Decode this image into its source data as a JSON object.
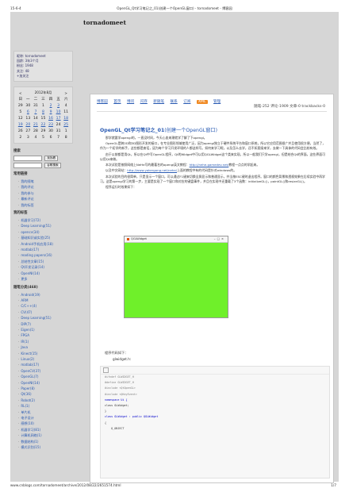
{
  "pdf": {
    "date": "15-6-4",
    "title": "OpenGL_Qt学习笔记之_01(创建一个OpenGL窗口) - tornadomeet - 博客园",
    "url": "www.cnblogs.com/tornadomeet/archive/2012/08/22/2651574.html",
    "page": "1/7"
  },
  "blog": {
    "title": "tornadomeet"
  },
  "sidebar": {
    "info": [
      "昵称: tornadomeet",
      "园龄: 3年3个月",
      "粉丝: 1948",
      "关注: 48",
      "+加关注"
    ],
    "calendar": {
      "prev": "<",
      "caption": "2012年8月",
      "next": ">",
      "weekdays": [
        "日",
        "一",
        "二",
        "三",
        "四",
        "五",
        "六"
      ],
      "rows": [
        [
          "29",
          "30",
          "31",
          "1",
          "2",
          "3",
          "4"
        ],
        [
          "5",
          "6",
          "7",
          "8",
          "9",
          "10",
          "11"
        ],
        [
          "12",
          "13",
          "14",
          "15",
          "16",
          "17",
          "18"
        ],
        [
          "19",
          "20",
          "21",
          "22",
          "23",
          "24",
          "25"
        ],
        [
          "26",
          "27",
          "28",
          "29",
          "30",
          "31",
          "1"
        ],
        [
          "2",
          "3",
          "4",
          "5",
          "6",
          "7",
          "8"
        ]
      ]
    },
    "search": {
      "heading": "搜索",
      "button1": "找找看",
      "button2": "谷歌搜索"
    },
    "common_links": {
      "heading": "常用链接",
      "items": [
        "我的随笔",
        "我的评论",
        "我的参与",
        "最新评论",
        "我的标签"
      ]
    },
    "my_tags": {
      "heading": "我的标签",
      "items": [
        "机器学习(72)",
        "Deep Learning(51)",
        "opencv(34)",
        "基础知识或实验(25)",
        "Android手机应用(18)",
        "matlab(17)",
        "reading papers(16)",
        "总结性文章(15)",
        "Qt开发记录(14)",
        "OpenNI(14)",
        "更多"
      ]
    },
    "categories": {
      "heading": "随笔分类(468)",
      "items": [
        "Android(19)",
        "ARM",
        "C/C++(4)",
        "CV(47)",
        "Deep Learning(51)",
        "DIP(7)",
        "Eigen(1)",
        "FPGA",
        "IR(1)",
        "Java",
        "Kinect(15)",
        "Linux(2)",
        "matlab(17)",
        "OpenCV(37)",
        "OpenGL(7)",
        "OpenNI(14)",
        "Paper(8)",
        "Qt(36)",
        "Robot(2)",
        "RL(1)",
        "单片机",
        "电子设计",
        "感想(10)",
        "机器学习(81)",
        "计算机网络(1)",
        "数据结构(1)",
        "模式识别(15)"
      ]
    }
  },
  "main": {
    "nav": [
      "博客园",
      "首页",
      "博问",
      "闪存",
      "新随笔",
      "联系",
      "订阅",
      "管理"
    ],
    "rss_label": "XML",
    "stats": "随笔-252  评论-1909  文章-0  trackbacks-0",
    "post_title": "OpenGL_Qt学习笔记之_01",
    "post_title_sub": "(创建一个OpenGL窗口)",
    "paragraphs": [
      "那学就要学opengl的，一直没时间，今天心血来潮就学了解了下opengl。",
      "OpenGL是跨2D和3D图形开发的接口，在专业图形领域使用广泛，因为opengl独立于硬件系统平台和窗口系统，所以它应用范围很广并且使用很方便。当然了，作为一个初学的新手，这些都是废话，因为每个学习开发环境的人都这样写。如何来学习呢，以及怎么去学，还不如直接来学，去做一下具体的代码会比较有效。",
      "由于以前都是用Qt，所以在Qt中写OpenGL程序，Qt的Widget中可以用QGLWidget这个类来实现，所以一般我们只学opengl，但是结合Qt的界面，这些界面可以用Qt来做。",
      "本次试验是按照网络上NeHe写的最著名的opengl英文教程：",
      "以及中文网站：",
      "本次试验的目的很简单，只是显示一个窗口，可以通过F1键来切换全屏显示和普通显示，并当按ESC键时退出程序。窗口的颜色背景和透视效果在后续实验中再学习。这是opengl学习的第一步，主要是实现了一个窗口和对应的键盘事件，并且在实现中还重载了3个函数：initializeGL()，paintGL()和resizeGL()。"
    ],
    "nehe_url": "http://nehe.gamedev.net/",
    "cn_url": "http://www.yakergong.net/nehe/",
    "nehe_url_tail": "教程一点点的学起来。",
    "cn_url_tail": "上面的教程中有的代码是针对windows的。",
    "screenshot_caption": "程序运行时效果如下：",
    "window_title": "QGLWidget",
    "gl_color": "#6ff02a",
    "code_caption": "程序代码如下：",
    "code_filename": "glwidget.h:",
    "code_lines": [
      "#ifndef GLWIDGET_H",
      "#define GLWIDGET_H",
      "",
      "#include <QtOpenGL>",
      "#include <QKeyEvent>",
      "",
      "namespace Ui {",
      "class GLWidget;",
      "}",
      "",
      "class GLWidget : public QGLWidget",
      "{",
      "    Q_OBJECT"
    ]
  },
  "colors": {
    "link": "#2a5bb3",
    "frame": "#d6d6d6"
  }
}
